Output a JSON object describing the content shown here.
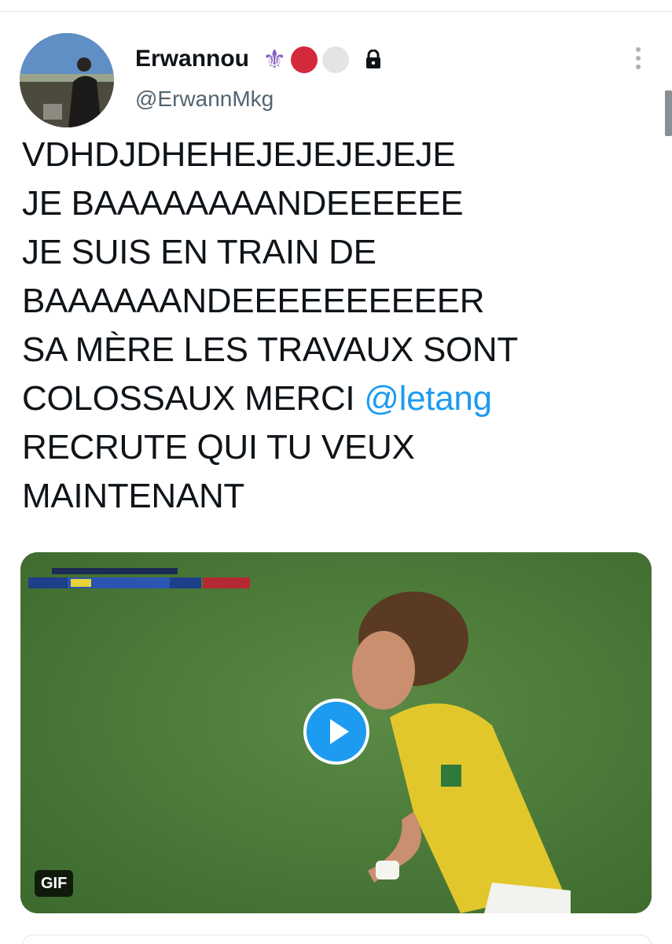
{
  "user": {
    "display_name": "Erwannou",
    "handle": "@ErwannMkg",
    "badges": [
      "fleur-de-lis-icon",
      "red-circle",
      "white-circle",
      "lock-icon"
    ],
    "badge_colors": {
      "fleur": "#8a5fbf",
      "red": "#d4283b",
      "white": "#e2e4e6"
    }
  },
  "tweet": {
    "lines": [
      "VDHDJDHEHEJEJEJEJEJE",
      "JE BAAAAAAAANDEEEEEE",
      "JE SUIS EN TRAIN DE",
      "BAAAAAANDEEEEEEEEEER",
      "SA MÈRE LES TRAVAUX SONT",
      "COLOSSAUX MERCI ",
      "RECRUTE QUI TU VEUX",
      "MAINTENANT"
    ],
    "mention": "@letang"
  },
  "media": {
    "badge": "GIF",
    "play_icon": "play-icon"
  },
  "colors": {
    "accent": "#1d9bf0",
    "text": "#0f1419",
    "secondary": "#536471"
  }
}
